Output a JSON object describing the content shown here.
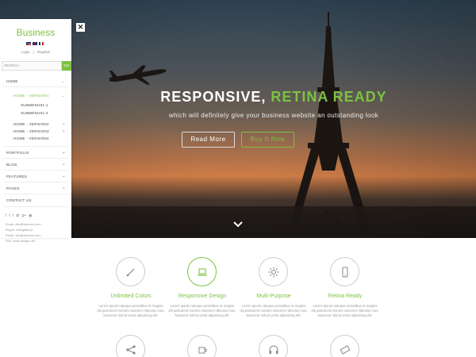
{
  "sidebar": {
    "logo": "Business",
    "auth": {
      "login": "Login",
      "separator": "|",
      "register": "Register"
    },
    "search": {
      "placeholder": "SEARCH",
      "go_label": "GO"
    },
    "nav": [
      {
        "label": "HOME",
        "chevron": "⌄"
      },
      {
        "label": "HOME - VERSION1",
        "chevron": "⌄"
      },
      {
        "label": "SUBMENU01-1"
      },
      {
        "label": "SUBMENU01-2"
      },
      {
        "label": "HOME - VERSION2",
        "chevron": "+"
      },
      {
        "label": "HOME - VERSION3",
        "chevron": "+"
      },
      {
        "label": "HOME - VERSION4"
      },
      {
        "label": "PORTFOLIO",
        "chevron": "+"
      },
      {
        "label": "BLOG",
        "chevron": "+"
      },
      {
        "label": "FEATURES",
        "chevron": "+"
      },
      {
        "label": "PAGES",
        "chevron": "+"
      },
      {
        "label": "CONTACT US"
      }
    ],
    "social_icons": [
      "facebook-icon",
      "twitter-icon",
      "tumblr-icon",
      "pinterest-icon",
      "googleplus-icon",
      "rss-icon"
    ],
    "contact": {
      "email1": "Email: abc@domain.com",
      "skype": "Skype: bmkgallery1",
      "email2": "Email: abc@domain.com",
      "site": "Site: www.design.net"
    }
  },
  "hero": {
    "close_label": "✕",
    "title_main": "RESPONSIVE, ",
    "title_accent": "RETINA READY",
    "subtitle": "which will definitely give your business website an outstanding look",
    "btn_more": "Read More",
    "btn_buy": "Buy It Now"
  },
  "features": [
    {
      "icon": "brush-icon",
      "title": "Unlimited Colors",
      "desc": "Lorem ipsulo natuque penatibus et magnis dis parturient montes nascetur ridiculus mus. Nascetur ridicul umsit adipiscing elit."
    },
    {
      "icon": "laptop-icon",
      "title": "Responsive Design",
      "desc": "Lorem ipsulo natuque penatibus et magnis dis parturient montes nascetur ridiculus mus. Nascetur ridicul umsit adipiscing elit."
    },
    {
      "icon": "sun-icon",
      "title": "Multi-Purpose",
      "desc": "Lorem ipsulo natuque penatibus et magnis dis parturient montes nascetur ridiculus mus. Nascetur ridicul umsit adipiscing elit."
    },
    {
      "icon": "phone-icon",
      "title": "Retina Ready",
      "desc": "Lorem ipsulo natuque penatibus et magnis dis parturient montes nascetur ridiculus mus. Nascetur ridicul umsit adipiscing elit."
    }
  ],
  "features_row2_icons": [
    "share-icon",
    "coffee-icon",
    "headphones-icon",
    "ticket-icon"
  ],
  "colors": {
    "accent": "#7cc242"
  }
}
